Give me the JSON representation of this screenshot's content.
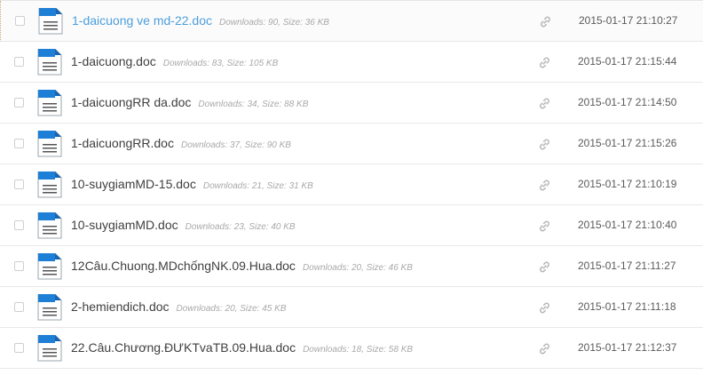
{
  "files": [
    {
      "name": "1-daicuong ve md-22.doc",
      "downloads_label": "Downloads: 90, Size: 36 KB",
      "date": "2015-01-17 21:10:27",
      "highlighted": true
    },
    {
      "name": "1-daicuong.doc",
      "downloads_label": "Downloads: 83, Size: 105 KB",
      "date": "2015-01-17 21:15:44"
    },
    {
      "name": "1-daicuongRR da.doc",
      "downloads_label": "Downloads: 34, Size: 88 KB",
      "date": "2015-01-17 21:14:50"
    },
    {
      "name": "1-daicuongRR.doc",
      "downloads_label": "Downloads: 37, Size: 90 KB",
      "date": "2015-01-17 21:15:26"
    },
    {
      "name": "10-suygiamMD-15.doc",
      "downloads_label": "Downloads: 21, Size: 31 KB",
      "date": "2015-01-17 21:10:19"
    },
    {
      "name": "10-suygiamMD.doc",
      "downloads_label": "Downloads: 23, Size: 40 KB",
      "date": "2015-01-17 21:10:40"
    },
    {
      "name": "12Câu.Chuong.MDchốngNK.09.Hua.doc",
      "downloads_label": "Downloads: 20, Size: 46 KB",
      "date": "2015-01-17 21:11:27"
    },
    {
      "name": "2-hemiendich.doc",
      "downloads_label": "Downloads: 20, Size: 45 KB",
      "date": "2015-01-17 21:11:18"
    },
    {
      "name": "22.Câu.Chương.ĐƯKTvaTB.09.Hua.doc",
      "downloads_label": "Downloads: 18, Size: 58 KB",
      "date": "2015-01-17 21:12:37"
    }
  ],
  "icons": {
    "file": "doc-file-icon",
    "link": "link-icon"
  },
  "colors": {
    "accent_link": "#4c9fdc",
    "doc_icon_blue": "#1e7fd6"
  }
}
